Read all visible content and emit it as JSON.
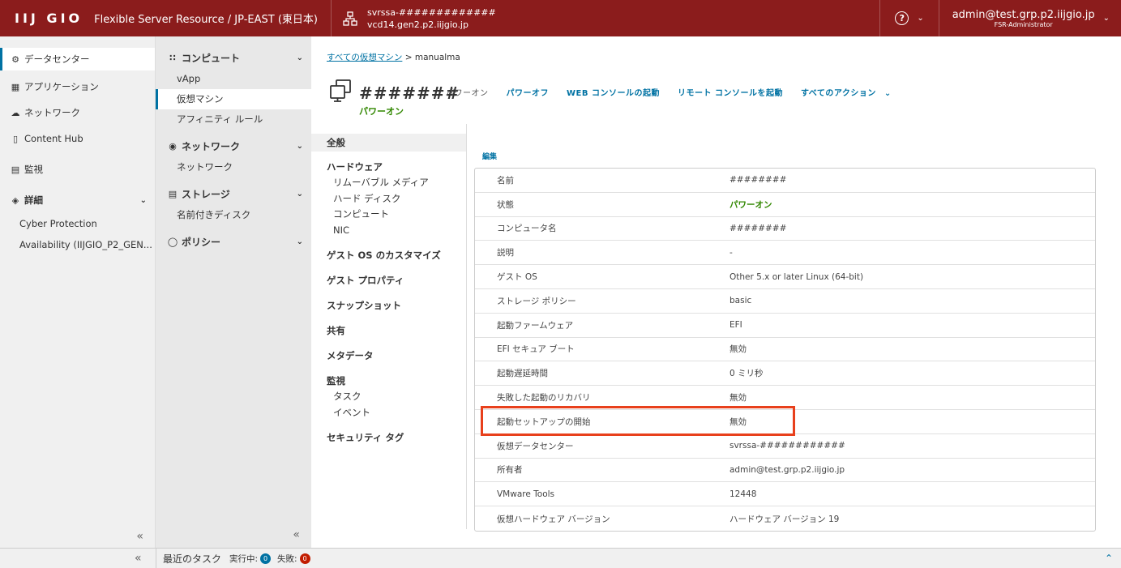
{
  "header": {
    "logo": "IIJ GIO",
    "product": "Flexible Server Resource / JP-EAST (東日本)",
    "org_name": "svrssa-#############",
    "org_host": "vcd14.gen2.p2.iijgio.jp",
    "help_icon": "?",
    "user_name": "admin@test.grp.p2.iijgio.jp",
    "user_role": "FSR-Administrator"
  },
  "leftnav": {
    "items": [
      {
        "label": "データセンター",
        "icon": "datacenter-icon"
      },
      {
        "label": "アプリケーション",
        "icon": "grid-icon"
      },
      {
        "label": "ネットワーク",
        "icon": "cloud-icon"
      },
      {
        "label": "Content Hub",
        "icon": "doc-icon"
      },
      {
        "label": "監視",
        "icon": "monitor-icon"
      },
      {
        "label": "詳細",
        "icon": "puzzle-icon"
      },
      {
        "label": "Cyber Protection"
      },
      {
        "label": "Availability (IIJGIO_P2_GEN..."
      }
    ]
  },
  "subnav": {
    "compute": "コンピュート",
    "vapp": "vApp",
    "vm": "仮想マシン",
    "affinity": "アフィニティ ルール",
    "network": "ネットワーク",
    "network_sub": "ネットワーク",
    "storage": "ストレージ",
    "named_disk": "名前付きディスク",
    "policy": "ポリシー"
  },
  "breadcrumb": {
    "link": "すべての仮想マシン",
    "sep": ">",
    "current": "manualma"
  },
  "vm": {
    "name": "#######",
    "status": "パワーオン"
  },
  "actions": {
    "power_on": "パワーオン",
    "power_off": "パワーオフ",
    "web_console": "WEB コンソールの起動",
    "remote_console": "リモート コンソールを起動",
    "all_actions": "すべてのアクション"
  },
  "sections": {
    "general": "全般",
    "hardware": "ハードウェア",
    "removable": "リムーバブル メディア",
    "hard_disk": "ハード ディスク",
    "compute": "コンピュート",
    "nic": "NIC",
    "guest_os_custom": "ゲスト OS のカスタマイズ",
    "guest_props": "ゲスト プロパティ",
    "snapshot": "スナップショット",
    "share": "共有",
    "metadata": "メタデータ",
    "monitor": "監視",
    "tasks": "タスク",
    "events": "イベント",
    "security_tags": "セキュリティ タグ"
  },
  "edit_label": "編集",
  "properties": [
    {
      "key": "名前",
      "value": "########"
    },
    {
      "key": "状態",
      "value": "パワーオン"
    },
    {
      "key": "コンピュータ名",
      "value": "########"
    },
    {
      "key": "説明",
      "value": "-"
    },
    {
      "key": "ゲスト OS",
      "value": "Other 5.x or later Linux (64-bit)"
    },
    {
      "key": "ストレージ ポリシー",
      "value": "basic"
    },
    {
      "key": "起動ファームウェア",
      "value": "EFI"
    },
    {
      "key": "EFI セキュア ブート",
      "value": "無効"
    },
    {
      "key": "起動遅延時間",
      "value": "0 ミリ秒"
    },
    {
      "key": "失敗した起動のリカバリ",
      "value": "無効"
    },
    {
      "key": "起動セットアップの開始",
      "value": "無効"
    },
    {
      "key": "仮想データセンター",
      "value": "svrssa-############"
    },
    {
      "key": "所有者",
      "value": "admin@test.grp.p2.iijgio.jp"
    },
    {
      "key": "VMware Tools",
      "value": "12448"
    },
    {
      "key": "仮想ハードウェア バージョン",
      "value": "ハードウェア バージョン 19"
    }
  ],
  "bottombar": {
    "recent_tasks": "最近のタスク",
    "running_label": "実行中:",
    "running_count": "0",
    "failed_label": "失敗:",
    "failed_count": "0"
  },
  "colors": {
    "header_bg": "#8b1c1c",
    "link": "#0072a3",
    "status_green": "#318700",
    "highlight": "#e8401c"
  }
}
